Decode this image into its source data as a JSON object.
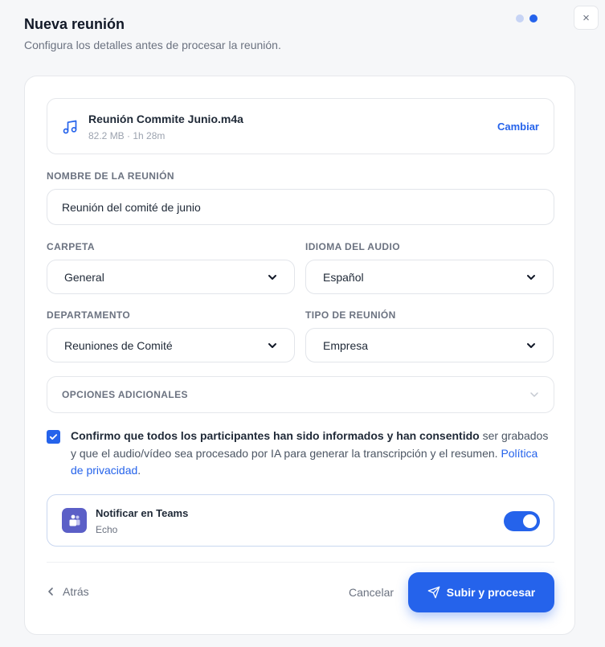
{
  "header": {
    "title": "Nueva reunión",
    "subtitle": "Configura los detalles antes de procesar la reunión.",
    "close": "×"
  },
  "steps": {
    "total": 2,
    "current": 2
  },
  "file": {
    "name": "Reunión Commite Junio.m4a",
    "meta": "82.2 MB · 1h 28m",
    "change_label": "Cambiar",
    "icon": "music-note-icon"
  },
  "form": {
    "name_label": "NOMBRE DE LA REUNIÓN",
    "name_value": "Reunión del comité de junio",
    "folder_label": "CARPETA",
    "folder_value": "General",
    "language_label": "IDIOMA DEL AUDIO",
    "language_value": "Español",
    "department_label": "DEPARTAMENTO",
    "department_value": "Reuniones de Comité",
    "type_label": "TIPO DE REUNIÓN",
    "type_value": "Empresa",
    "extra_label": "OPCIONES ADICIONALES"
  },
  "consent": {
    "checked": true,
    "bold": "Confirmo que todos los participantes han sido informados y han consentido",
    "text": " ser grabados y que el audio/vídeo sea procesado por IA para generar la transcripción y el resumen. ",
    "link": "Política de privacidad",
    "end": "."
  },
  "teams": {
    "title": "Notificar en Teams",
    "subtitle": "Echo",
    "enabled": true
  },
  "footer": {
    "back": "Atrás",
    "cancel": "Cancelar",
    "submit": "Subir y procesar"
  },
  "colors": {
    "accent": "#2563eb",
    "teams": "#5b5fc7"
  }
}
